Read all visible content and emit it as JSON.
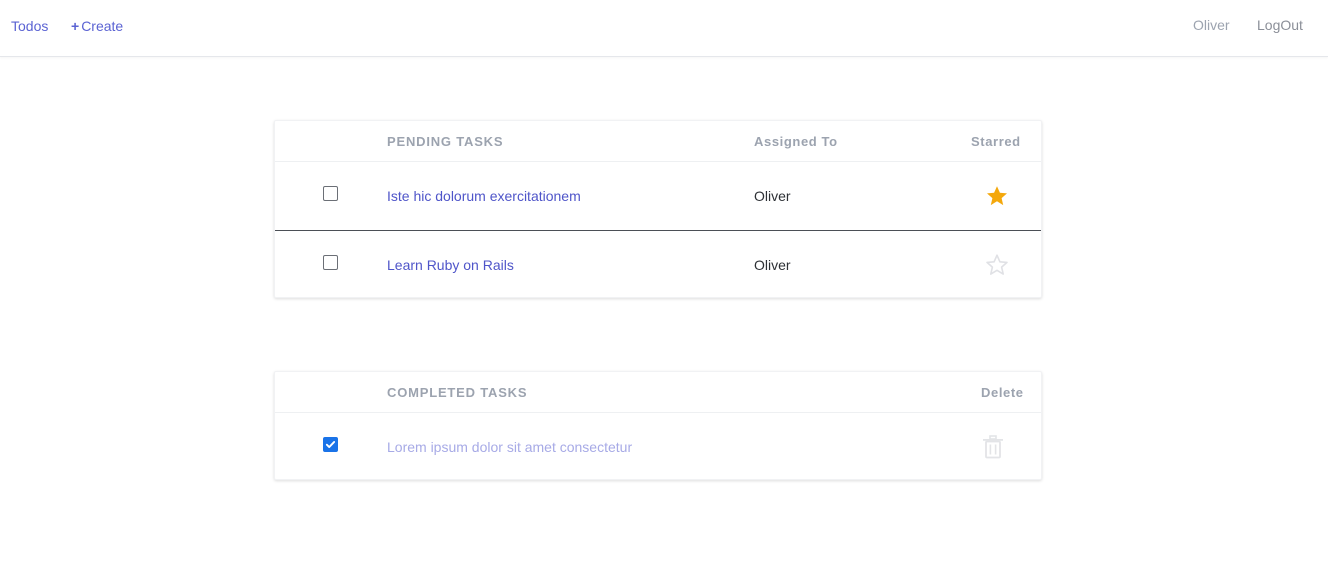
{
  "nav": {
    "todos_label": "Todos",
    "create_plus": "+",
    "create_label": "Create",
    "user_name": "Oliver",
    "logout_label": "LogOut"
  },
  "pending": {
    "header_title": "PENDING TASKS",
    "header_assigned": "Assigned To",
    "header_starred": "Starred",
    "rows": [
      {
        "title": "Iste hic dolorum exercitationem",
        "assignee": "Oliver",
        "starred": true,
        "checked": false
      },
      {
        "title": "Learn Ruby on Rails",
        "assignee": "Oliver",
        "starred": false,
        "checked": false
      }
    ]
  },
  "completed": {
    "header_title": "COMPLETED TASKS",
    "header_delete": "Delete",
    "rows": [
      {
        "title": "Lorem ipsum dolor sit amet consectetur",
        "checked": true
      }
    ]
  },
  "colors": {
    "accent": "#5b63d3",
    "star_filled": "#f4a80c",
    "star_empty": "#e3e4e7",
    "checkbox_checked": "#1a73e8",
    "trash": "#e3e4e7"
  },
  "icons": {
    "star_filled": "star-filled-icon",
    "star_empty": "star-outline-icon",
    "delete": "trash-icon",
    "checkmark": "checkmark-icon"
  }
}
